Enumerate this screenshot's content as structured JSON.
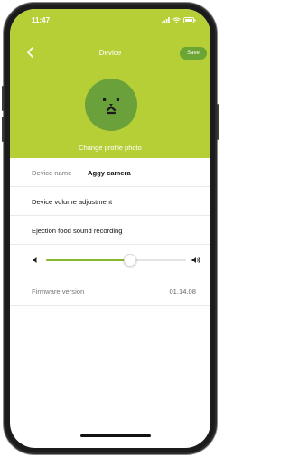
{
  "status_bar": {
    "time": "11:47"
  },
  "nav": {
    "title": "Device",
    "save_label": "Save"
  },
  "profile": {
    "change_photo_label": "Change profile photo"
  },
  "device_name": {
    "label": "Device name",
    "value": "Aggy camera"
  },
  "volume": {
    "label": "Device volume adjustment",
    "level_fraction": 0.6
  },
  "ejection": {
    "label": "Ejection food sound recording"
  },
  "firmware": {
    "label": "Firmware version",
    "value": "01.14.08"
  },
  "colors": {
    "accent": "#b7cf37",
    "save_button": "#6ba534",
    "avatar": "#6aa13a",
    "slider_fill": "#86b82c"
  }
}
